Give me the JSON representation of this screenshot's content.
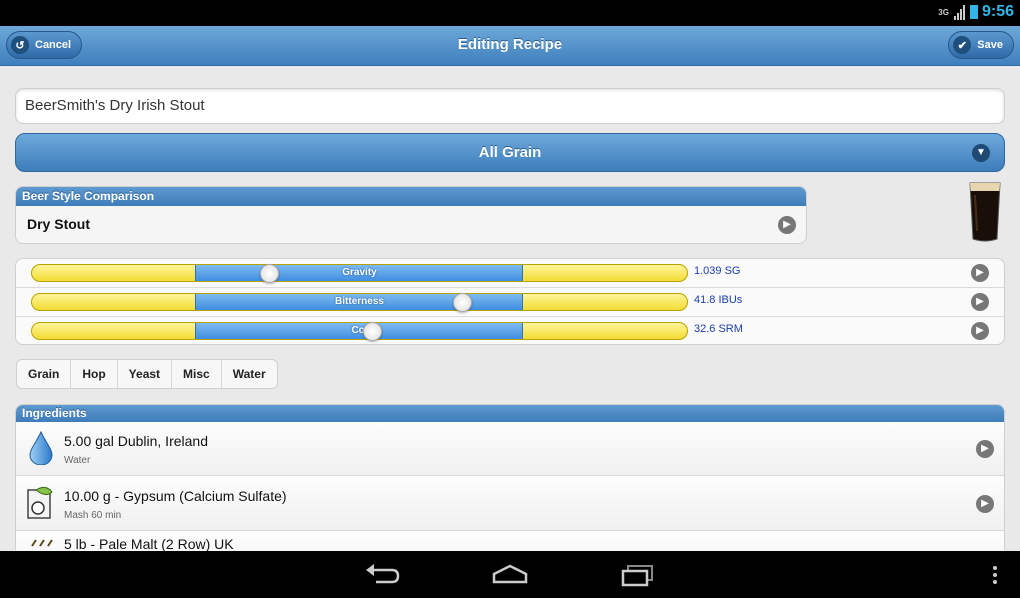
{
  "status": {
    "time": "9:56",
    "network": "3G"
  },
  "header": {
    "title": "Editing Recipe",
    "cancel_label": "Cancel",
    "save_label": "Save"
  },
  "recipe": {
    "name": "BeerSmith's Dry Irish Stout",
    "type": "All Grain"
  },
  "style": {
    "heading": "Beer Style Comparison",
    "value": "Dry Stout"
  },
  "stats": [
    {
      "label": "Gravity",
      "value": "1.039 SG",
      "range_start": 0.25,
      "range_end": 0.75,
      "current": 0.36
    },
    {
      "label": "Bitterness",
      "value": "41.8 IBUs",
      "range_start": 0.25,
      "range_end": 0.75,
      "current": 0.66
    },
    {
      "label": "Col",
      "value": "32.6 SRM",
      "range_start": 0.25,
      "range_end": 0.75,
      "current": 0.51
    }
  ],
  "tabs": [
    "Grain",
    "Hop",
    "Yeast",
    "Misc",
    "Water"
  ],
  "ingredients": {
    "heading": "Ingredients",
    "items": [
      {
        "title": "5.00 gal Dublin, Ireland",
        "subtitle": "Water",
        "icon": "water-drop-icon"
      },
      {
        "title": "10.00 g - Gypsum (Calcium Sulfate)",
        "subtitle": "Mash 60 min",
        "icon": "misc-additive-icon"
      },
      {
        "title": "5 lb - Pale Malt (2 Row) UK",
        "subtitle": "",
        "icon": "grain-icon"
      }
    ]
  },
  "colors": {
    "accent": "#3f7fbd",
    "bar_yellow": "#f3dc33",
    "bar_blue": "#3f8ee0",
    "value_text": "#1a3ea8"
  }
}
